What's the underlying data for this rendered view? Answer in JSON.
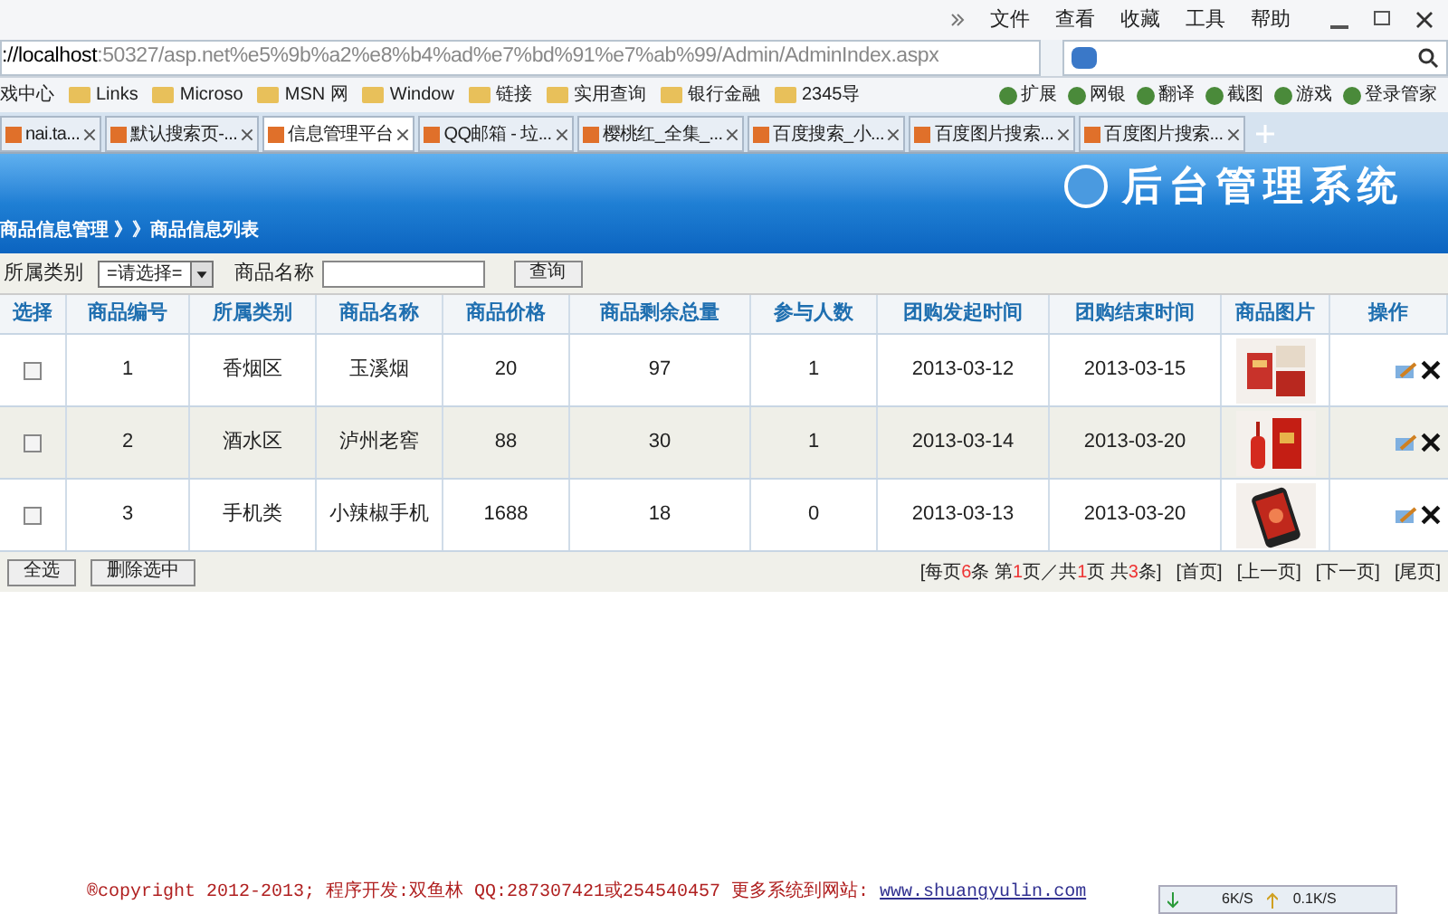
{
  "browser": {
    "menu": [
      "文件",
      "查看",
      "收藏",
      "工具",
      "帮助"
    ],
    "address": {
      "host": "://localhost",
      "rest": ":50327/asp.net%e5%9b%a2%e8%b4%ad%e7%bd%91%e7%ab%99/Admin/AdminIndex.aspx"
    },
    "bookmarks": [
      "戏中心",
      "Links",
      "Microso",
      "MSN 网",
      "Window",
      "链接",
      "实用查询",
      "银行金融",
      "2345导"
    ],
    "tools": [
      "扩展",
      "网银",
      "翻译",
      "截图",
      "游戏",
      "登录管家"
    ],
    "tabs": [
      {
        "label": "nai.ta...",
        "selected": false
      },
      {
        "label": "默认搜索页-...",
        "selected": false
      },
      {
        "label": "信息管理平台",
        "selected": true
      },
      {
        "label": "QQ邮箱 - 垃...",
        "selected": false
      },
      {
        "label": "樱桃红_全集_...",
        "selected": false
      },
      {
        "label": "百度搜索_小...",
        "selected": false
      },
      {
        "label": "百度图片搜索...",
        "selected": false
      },
      {
        "label": "百度图片搜索...",
        "selected": false
      }
    ]
  },
  "header": {
    "title": "后台管理系统"
  },
  "breadcrumb": "商品信息管理 》》商品信息列表",
  "filter": {
    "category_label": "所属类别",
    "category_value": "=请选择=",
    "name_label": "商品名称",
    "search_button": "查询"
  },
  "table": {
    "select_header": "选择",
    "columns": [
      "商品编号",
      "所属类别",
      "商品名称",
      "商品价格",
      "商品剩余总量",
      "参与人数",
      "团购发起时间",
      "团购结束时间",
      "商品图片",
      "操作"
    ],
    "rows": [
      {
        "checked": false,
        "cells": [
          "1",
          "香烟区",
          "玉溪烟",
          "20",
          "97",
          "1",
          "2013-03-12",
          "2013-03-15"
        ]
      },
      {
        "checked": false,
        "cells": [
          "2",
          "酒水区",
          "泸州老窖",
          "88",
          "30",
          "1",
          "2013-03-14",
          "2013-03-20"
        ]
      },
      {
        "checked": false,
        "cells": [
          "3",
          "手机类",
          "小辣椒手机",
          "1688",
          "18",
          "0",
          "2013-03-13",
          "2013-03-20"
        ]
      }
    ]
  },
  "actions": [
    "全选",
    "删除选中"
  ],
  "pager": {
    "info": [
      {
        "text": "[每页",
        "highlight": false
      },
      {
        "text": "6",
        "highlight": true
      },
      {
        "text": "条 第",
        "highlight": false
      },
      {
        "text": "1",
        "highlight": true
      },
      {
        "text": "页／共",
        "highlight": false
      },
      {
        "text": "1",
        "highlight": true
      },
      {
        "text": "页 共",
        "highlight": false
      },
      {
        "text": "3",
        "highlight": true
      },
      {
        "text": "条]",
        "highlight": false
      }
    ],
    "links": [
      "[首页]",
      "[上一页]",
      "[下一页]",
      "[尾页]"
    ]
  },
  "footer": {
    "text": "®copyright 2012-2013; 程序开发:双鱼林  QQ:287307421或254540457  更多系统到网站: ",
    "link": "www.shuangyulin.com"
  },
  "status": {
    "down": "6K/S",
    "up": "0.1K/S"
  }
}
